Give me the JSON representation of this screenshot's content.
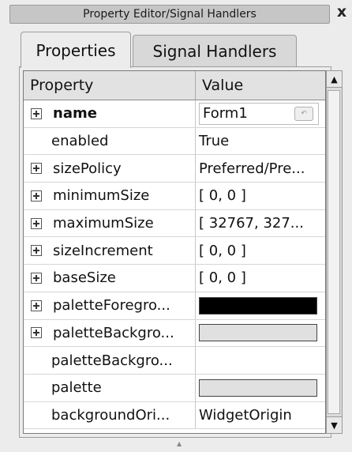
{
  "window": {
    "title": "Property Editor/Signal Handlers",
    "close_label": "x"
  },
  "tabs": [
    {
      "label": "Properties",
      "active": true
    },
    {
      "label": "Signal Handlers",
      "active": false
    }
  ],
  "table": {
    "columns": [
      "Property",
      "Value"
    ],
    "rows": [
      {
        "name": "name",
        "value": "Form1",
        "expandable": true,
        "bold": true,
        "editor": "text-with-reset"
      },
      {
        "name": "enabled",
        "value": "True",
        "expandable": false
      },
      {
        "name": "sizePolicy",
        "value": "Preferred/Pre...",
        "expandable": true
      },
      {
        "name": "minimumSize",
        "value": "[ 0, 0 ]",
        "expandable": true
      },
      {
        "name": "maximumSize",
        "value": "[ 32767, 327...",
        "expandable": true
      },
      {
        "name": "sizeIncrement",
        "value": "[ 0, 0 ]",
        "expandable": true
      },
      {
        "name": "baseSize",
        "value": "[ 0, 0 ]",
        "expandable": true
      },
      {
        "name": "paletteForegro...",
        "value": "",
        "expandable": true,
        "swatch": "#000000"
      },
      {
        "name": "paletteBackgro...",
        "value": "",
        "expandable": true,
        "swatch": "#e0e0e0"
      },
      {
        "name": "paletteBackgro...",
        "value": "",
        "expandable": false
      },
      {
        "name": "palette",
        "value": "",
        "expandable": false,
        "swatch": "#e0e0e0"
      },
      {
        "name": "backgroundOri...",
        "value": "WidgetOrigin",
        "expandable": false
      }
    ]
  },
  "icons": {
    "expander": "plus-box-icon",
    "scroll_up": "arrow-up-icon",
    "scroll_down": "arrow-down-icon",
    "reset": "reset-arrow-icon"
  }
}
